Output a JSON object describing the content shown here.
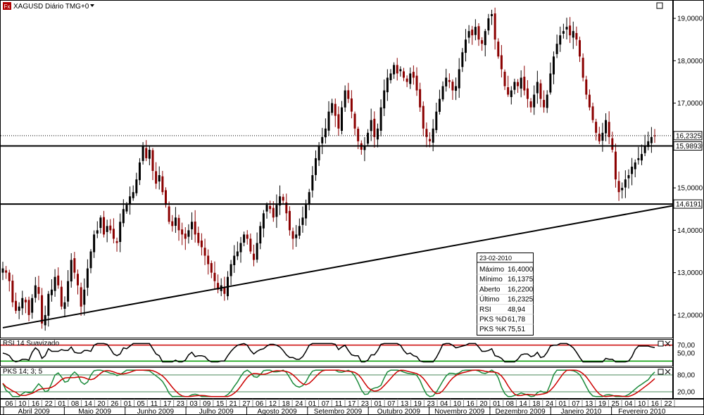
{
  "window": {
    "title": "XAGUSD Diário TMG+0"
  },
  "chart_data": [
    {
      "type": "candlestick",
      "title": "XAGUSD Diário TMG+0",
      "ylim": [
        11.5,
        19.4
      ],
      "y_ticks": [
        "19,0000",
        "18,0000",
        "17,0000",
        "16,0000",
        "15,0000",
        "14,0000",
        "13,0000",
        "12,0000"
      ],
      "y_tick_values": [
        19,
        18,
        17,
        16,
        15,
        14,
        13,
        12
      ],
      "price_tags": [
        {
          "label": "16,2325",
          "value": 16.2325,
          "style": "current"
        },
        {
          "label": "15,9893",
          "value": 15.9893,
          "style": "line"
        },
        {
          "label": "14,6191",
          "value": 14.6191,
          "style": "line"
        }
      ],
      "horizontal_lines": [
        15.9893,
        14.6191
      ],
      "dotted_line": 16.2325,
      "trendline": {
        "from": {
          "i": 0,
          "v": 11.7
        },
        "to": {
          "i": 232,
          "v": 14.95
        }
      },
      "closes": [
        13.1,
        13.0,
        12.8,
        12.3,
        12.1,
        12.2,
        12.4,
        12.3,
        12.0,
        12.4,
        12.7,
        12.5,
        11.8,
        12.0,
        12.5,
        12.6,
        12.9,
        12.7,
        12.2,
        12.3,
        12.8,
        13.3,
        13.0,
        12.7,
        12.2,
        12.6,
        13.1,
        13.5,
        13.9,
        14.0,
        14.3,
        13.9,
        14.1,
        14.0,
        13.8,
        13.7,
        14.2,
        14.5,
        14.6,
        14.8,
        14.9,
        15.2,
        15.6,
        16.0,
        15.7,
        15.9,
        15.4,
        15.1,
        15.3,
        14.9,
        14.6,
        14.2,
        14.1,
        14.3,
        14.0,
        13.9,
        13.8,
        14.0,
        14.2,
        13.9,
        13.7,
        13.6,
        13.4,
        13.2,
        13.0,
        12.8,
        12.6,
        12.7,
        12.5,
        12.9,
        13.2,
        13.4,
        13.5,
        13.7,
        13.9,
        13.8,
        13.5,
        13.3,
        13.7,
        14.1,
        14.4,
        14.6,
        14.5,
        14.3,
        14.6,
        14.8,
        14.7,
        14.4,
        14.0,
        13.8,
        13.9,
        14.1,
        14.3,
        14.6,
        14.9,
        15.3,
        15.7,
        16.0,
        16.2,
        16.4,
        16.8,
        17.0,
        16.7,
        16.4,
        16.9,
        17.3,
        17.1,
        16.8,
        16.4,
        16.1,
        15.9,
        16.0,
        16.3,
        16.6,
        16.2,
        16.4,
        16.9,
        17.3,
        17.6,
        17.7,
        17.9,
        17.7,
        17.8,
        17.6,
        17.5,
        17.7,
        17.6,
        17.3,
        16.9,
        16.4,
        16.2,
        16.1,
        16.4,
        16.8,
        17.1,
        17.4,
        17.6,
        17.5,
        17.3,
        17.4,
        17.8,
        18.2,
        18.5,
        18.7,
        18.6,
        18.8,
        18.5,
        18.4,
        18.7,
        19.0,
        19.1,
        18.5,
        18.1,
        17.8,
        17.4,
        17.2,
        17.3,
        17.5,
        17.4,
        17.6,
        17.3,
        17.1,
        16.9,
        17.2,
        17.5,
        17.1,
        16.9,
        17.2,
        17.7,
        18.1,
        18.4,
        18.6,
        18.7,
        18.8,
        18.6,
        18.7,
        18.5,
        18.1,
        17.6,
        17.2,
        16.9,
        16.6,
        16.3,
        16.1,
        16.3,
        16.6,
        16.2,
        15.9,
        15.2,
        14.9,
        15.0,
        15.2,
        15.3,
        15.5,
        15.6,
        15.7,
        15.8,
        16.0,
        16.1,
        16.2,
        16.23
      ]
    },
    {
      "type": "line",
      "title": "RSI 14 Suavizado",
      "y_ticks": [
        "70,00",
        "50,00"
      ],
      "y_tick_values": [
        70,
        50
      ],
      "ylim": [
        20,
        80
      ],
      "levels": [
        {
          "value": 70,
          "color": "#cc0000"
        },
        {
          "value": 30,
          "color": "#009900"
        }
      ]
    },
    {
      "type": "line",
      "title": "PKS 14; 3; 5",
      "y_ticks": [
        "80,00",
        "20,00"
      ],
      "y_tick_values": [
        80,
        20
      ],
      "ylim": [
        0,
        100
      ],
      "series": [
        {
          "name": "PKS %D",
          "color": "#cc0000"
        },
        {
          "name": "PKS %K",
          "color": "#1a8a3a"
        }
      ]
    }
  ],
  "x_axis": {
    "days": [
      "06",
      "10",
      "16",
      "22",
      "01",
      "08",
      "14",
      "20",
      "26",
      "01",
      "05",
      "11",
      "17",
      "23",
      "03",
      "09",
      "15",
      "21",
      "27",
      "06",
      "12",
      "18",
      "24",
      "01",
      "07",
      "11",
      "17",
      "23",
      "01",
      "07",
      "13",
      "19",
      "23",
      "04",
      "10",
      "16",
      "20",
      "01",
      "08",
      "14",
      "18",
      "24",
      "01",
      "07",
      "13",
      "19",
      "25",
      "04",
      "10",
      "16",
      "22"
    ],
    "months": [
      "Abril 2009",
      "Maio 2009",
      "Junho 2009",
      "Julho 2009",
      "Agosto 2009",
      "Setembro 2009",
      "Outubro 2009",
      "Novembro 2009",
      "Dezembro 2009",
      "Janeiro 2010",
      "Fevereiro 2010"
    ]
  },
  "info_box": {
    "date": "23-02-2010",
    "rows": [
      {
        "label": "Máximo",
        "value": "16,4000",
        "color": "#000000"
      },
      {
        "label": "Mínimo",
        "value": "16,1375",
        "color": "#000000"
      },
      {
        "label": "Aberto",
        "value": "16,2200",
        "color": "#000000"
      },
      {
        "label": "Último",
        "value": "16,2325",
        "color": "#1a8a3a"
      },
      {
        "label": "RSI",
        "value": "48,94",
        "color": "#000000"
      },
      {
        "label": "PKS %D",
        "value": "61,78",
        "color": "#cc0000"
      },
      {
        "label": "PKS %K",
        "value": "75,51",
        "color": "#1a8a3a"
      }
    ]
  },
  "colors": {
    "up": "#000000",
    "down": "#8b0000",
    "accent_red": "#cc0000",
    "accent_green": "#1a8a3a"
  }
}
